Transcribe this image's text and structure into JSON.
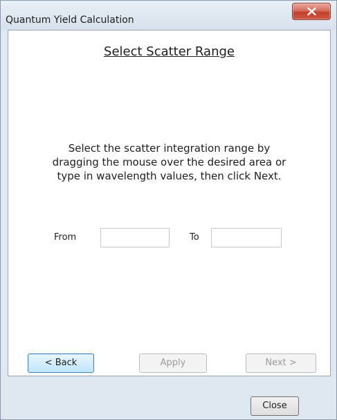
{
  "window": {
    "title": "Quantum Yield Calculation"
  },
  "page": {
    "heading": "Select Scatter Range",
    "instructions": [
      "Select the scatter integration range by",
      "dragging the mouse over the desired area or",
      "type in wavelength values, then click Next."
    ]
  },
  "range": {
    "from_label": "From",
    "from_value": "",
    "to_label": "To",
    "to_value": ""
  },
  "nav": {
    "back_label": "< Back",
    "apply_label": "Apply",
    "next_label": "Next >"
  },
  "footer": {
    "close_label": "Close"
  },
  "colors": {
    "window_frame": "#dfe7f0",
    "close_caption": "#c2412c",
    "focus_border": "#3c7fb1"
  }
}
